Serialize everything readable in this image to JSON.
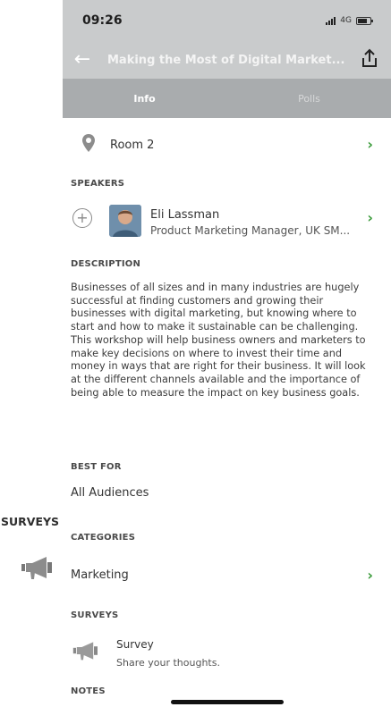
{
  "status": {
    "time": "09:26",
    "network": "4G"
  },
  "header": {
    "title": "Making the Most of Digital Market..."
  },
  "tabs": [
    {
      "label": "Info"
    },
    {
      "label": "Polls"
    }
  ],
  "location": {
    "label": "Room 2"
  },
  "sections": {
    "speakers": "SPEAKERS",
    "description": "DESCRIPTION",
    "best_for": "BEST FOR",
    "categories": "CATEGORIES",
    "surveys": "SURVEYS",
    "notes": "NOTES"
  },
  "speaker": {
    "name": "Eli Lassman",
    "role": "Product Marketing Manager, UK SM..."
  },
  "description": "Businesses of all sizes and in many industries are hugely successful at finding customers and growing their businesses with digital marketing, but knowing where to start and how to make it sustainable can be challenging. This workshop will help business owners and marketers to make key decisions on where to invest their time and money in ways that are right for their business. It will look at the different channels available and the importance of being able to measure the impact on key business goals.",
  "best_for": "All Audiences",
  "category": "Marketing",
  "survey": {
    "title": "Survey",
    "subtitle": "Share your thoughts."
  },
  "outside": {
    "label": "SURVEYS"
  },
  "colors": {
    "accent": "#3a9b3a",
    "header_bg": "#c9cbcc",
    "tabs_bg": "#a9acae"
  }
}
